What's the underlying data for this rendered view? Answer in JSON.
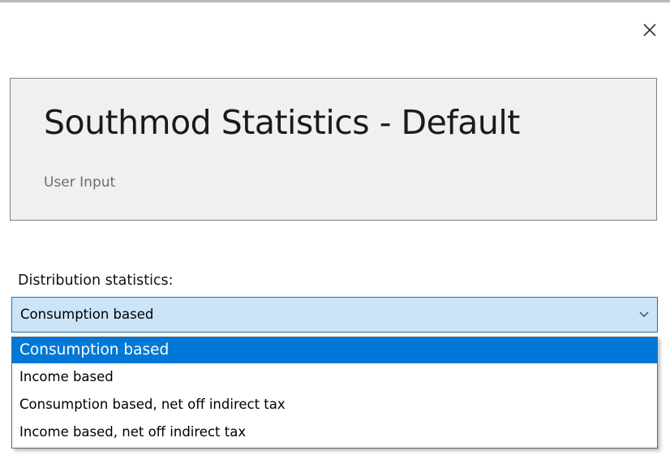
{
  "window": {
    "close_icon": "close-icon"
  },
  "header": {
    "title": "Southmod Statistics - Default",
    "subtitle": "User Input"
  },
  "distribution": {
    "label": "Distribution statistics:",
    "selected_value": "Consumption based",
    "chevron_icon": "chevron-down-icon",
    "options": [
      {
        "label": "Consumption based",
        "selected": true
      },
      {
        "label": "Income based",
        "selected": false
      },
      {
        "label": "Consumption based, net off indirect tax",
        "selected": false
      },
      {
        "label": "Income based, net off indirect tax",
        "selected": false
      }
    ]
  },
  "colors": {
    "accent": "#0078d7",
    "select_background": "#cce4f7",
    "header_background": "#f0f0f0"
  }
}
